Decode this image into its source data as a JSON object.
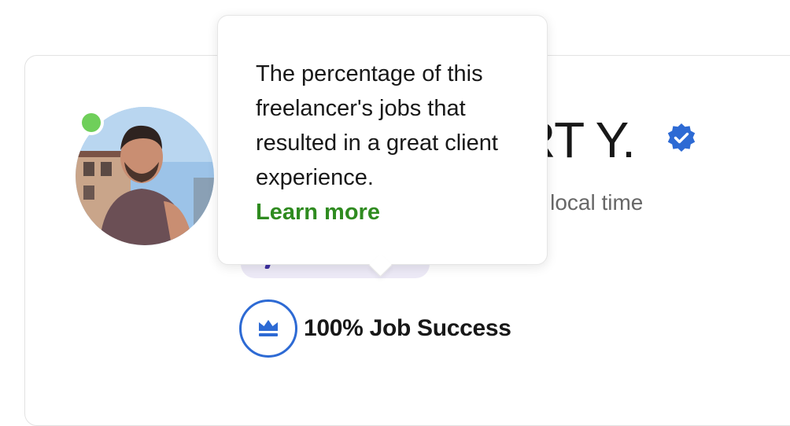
{
  "profile": {
    "name": "RT Y.",
    "local_time": "m local time",
    "online": true,
    "avatar_icon": "freelancer-photo",
    "verified_icon": "verified-badge-icon"
  },
  "tooltip": {
    "text": "The percentage of this freelancer's jobs that resulted in a great client experience.",
    "link": "Learn more"
  },
  "job_success": {
    "percent": 100,
    "label": "100% Job Success",
    "icon": "crown-icon"
  },
  "colors": {
    "online_green": "#6fcf5a",
    "verified_blue": "#2d6ad4",
    "link_green": "#2f8b20",
    "badge_lavender": "#ece9f6"
  }
}
